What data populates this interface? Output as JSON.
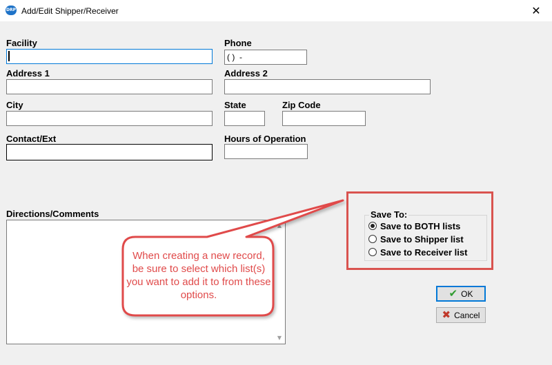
{
  "window": {
    "title": "Add/Edit Shipper/Receiver",
    "app_icon": "DRP",
    "close": "✕"
  },
  "fields": {
    "facility": {
      "label": "Facility",
      "value": ""
    },
    "phone": {
      "label": "Phone",
      "value": "( )  -"
    },
    "address1": {
      "label": "Address 1",
      "value": ""
    },
    "address2": {
      "label": "Address 2",
      "value": ""
    },
    "city": {
      "label": "City",
      "value": ""
    },
    "state": {
      "label": "State",
      "value": ""
    },
    "zip": {
      "label": "Zip Code",
      "value": ""
    },
    "contact": {
      "label": "Contact/Ext",
      "value": ""
    },
    "hours": {
      "label": "Hours of Operation",
      "value": ""
    },
    "directions": {
      "label": "Directions/Comments",
      "value": ""
    }
  },
  "save_to": {
    "legend": "Save To:",
    "options": [
      {
        "label": "Save to BOTH lists",
        "checked": true
      },
      {
        "label": "Save to Shipper list",
        "checked": false
      },
      {
        "label": "Save to Receiver list",
        "checked": false
      }
    ]
  },
  "buttons": {
    "ok": {
      "label": "OK",
      "icon": "checkmark-icon",
      "icon_color": "#2e9b2e"
    },
    "cancel": {
      "label": "Cancel",
      "icon": "x-icon",
      "icon_color": "#c0392b"
    }
  },
  "callout": {
    "text": "When creating a new record, be sure to select which list(s) you want to add it to from these options.",
    "color": "#e04a4a"
  }
}
